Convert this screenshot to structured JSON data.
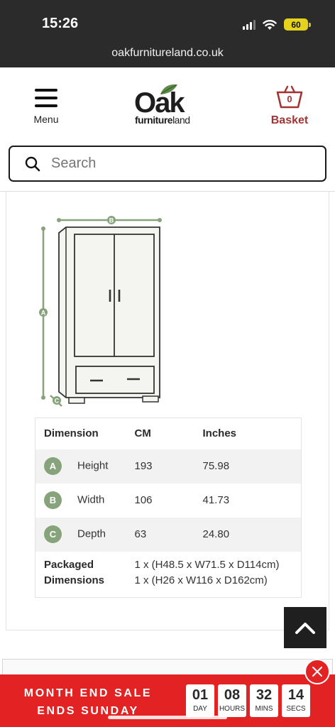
{
  "status": {
    "time": "15:26",
    "battery": "60"
  },
  "browser": {
    "url": "oakfurnitureland.co.uk"
  },
  "header": {
    "menu_label": "Menu",
    "logo_main": "Oak",
    "logo_sub_bold": "furniture",
    "logo_sub_light": "land",
    "basket_count": "0",
    "basket_label": "Basket"
  },
  "search": {
    "placeholder": "Search"
  },
  "diagram": {
    "labels": [
      "A",
      "B",
      "C"
    ]
  },
  "dimensions": {
    "headers": [
      "Dimension",
      "CM",
      "Inches"
    ],
    "rows": [
      {
        "letter": "A",
        "name": "Height",
        "cm": "193",
        "inches": "75.98"
      },
      {
        "letter": "B",
        "name": "Width",
        "cm": "106",
        "inches": "41.73"
      },
      {
        "letter": "C",
        "name": "Depth",
        "cm": "63",
        "inches": "24.80"
      }
    ],
    "packaged_label_line1": "Packaged",
    "packaged_label_line2": "Dimensions",
    "packaged_values": [
      "1 x (H48.5 x W71.5 x D114cm)",
      "1 x (H26 x W116 x D162cm)"
    ]
  },
  "sale_banner": {
    "line1": "MONTH END SALE",
    "line2": "ENDS SUNDAY",
    "countdown": [
      {
        "value": "01",
        "unit": "DAY"
      },
      {
        "value": "08",
        "unit": "HOURS"
      },
      {
        "value": "32",
        "unit": "MINS"
      },
      {
        "value": "14",
        "unit": "SECS"
      }
    ]
  },
  "colors": {
    "accent_red": "#e32323",
    "basket_red": "#a33434",
    "dimension_green": "#87a37b"
  }
}
